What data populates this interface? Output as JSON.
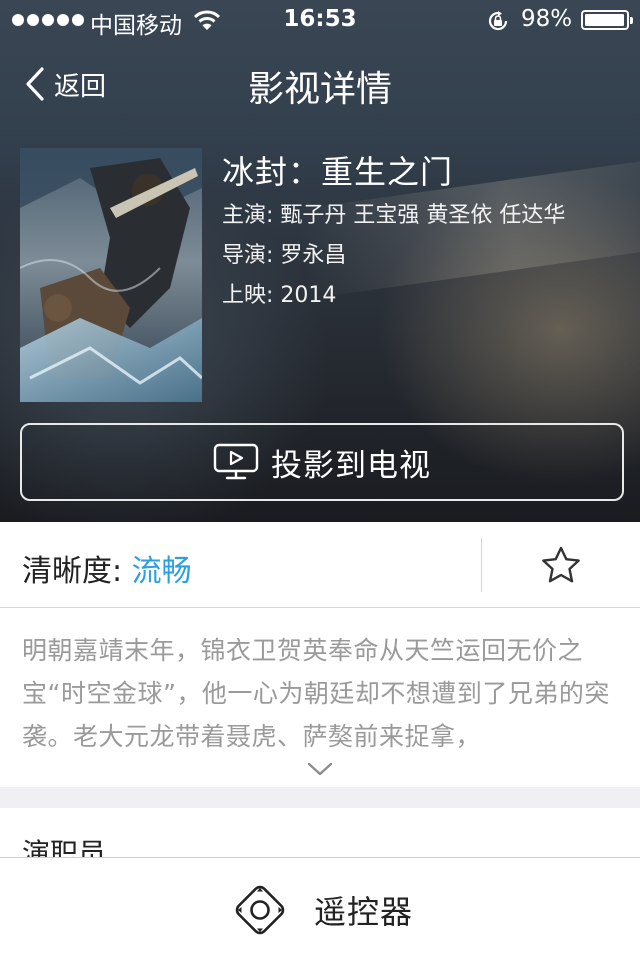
{
  "status_bar": {
    "carrier": "中国移动",
    "time": "16:53",
    "battery_percent": "98%",
    "battery_level": 0.98,
    "icons": [
      "signal-dots-icon",
      "wifi-icon",
      "rotation-lock-icon",
      "battery-icon"
    ]
  },
  "nav": {
    "back_label": "返回",
    "title": "影视详情"
  },
  "movie": {
    "title": "冰封：重生之门",
    "starring": "主演: 甄子丹 王宝强 黄圣依 任达华",
    "director": "导演: 罗永昌",
    "release": "上映: 2014"
  },
  "cast_button": {
    "label": "投影到电视",
    "icon": "tv-play-icon"
  },
  "quality": {
    "label": "清晰度: ",
    "value": "流畅",
    "favorite_icon": "star-icon"
  },
  "synopsis": {
    "text": "明朝嘉靖末年，锦衣卫贺英奉命从天竺运回无价之宝“时空金球”，他一心为朝廷却不想遭到了兄弟的突袭。老大元龙带着聂虎、萨獒前来捉拿，",
    "expand_icon": "chevron-down-icon"
  },
  "cast_section": {
    "heading": "演职员"
  },
  "bottom_bar": {
    "remote_label": "遥控器",
    "remote_icon": "remote-dpad-icon"
  },
  "colors": {
    "accent": "#2a9fe4",
    "nav_bg": "#36414f",
    "synopsis_text": "#9a9a9a",
    "section_gap": "#efeff4"
  }
}
